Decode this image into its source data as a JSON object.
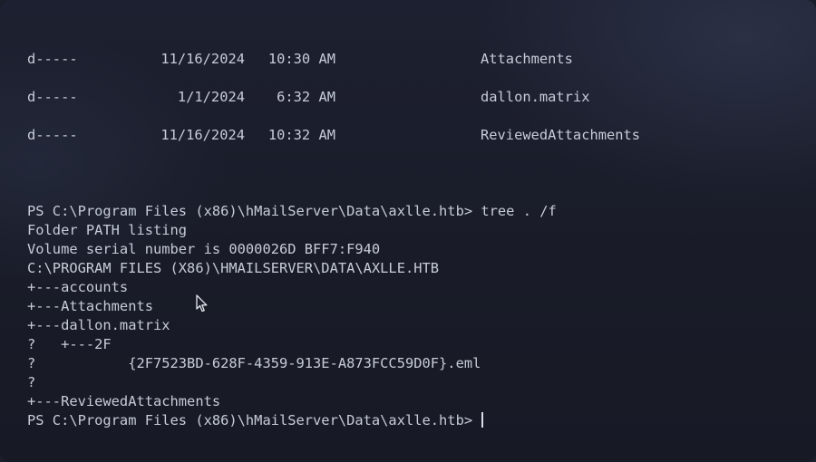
{
  "terminal": {
    "dir_listing": [
      {
        "mode": "d-----",
        "date": "11/16/2024",
        "time": "10:30 AM",
        "name": "Attachments"
      },
      {
        "mode": "d-----",
        "date": "1/1/2024",
        "time": "6:32 AM",
        "name": "dallon.matrix"
      },
      {
        "mode": "d-----",
        "date": "11/16/2024",
        "time": "10:32 AM",
        "name": "ReviewedAttachments"
      }
    ],
    "lines": [
      "PS C:\\Program Files (x86)\\hMailServer\\Data\\axlle.htb> tree . /f",
      "Folder PATH listing",
      "Volume serial number is 0000026D BFF7:F940",
      "C:\\PROGRAM FILES (X86)\\HMAILSERVER\\DATA\\AXLLE.HTB",
      "+---accounts",
      "+---Attachments",
      "+---dallon.matrix",
      "?   +---2F",
      "?           {2F7523BD-628F-4359-913E-A873FCC59D0F}.eml",
      "?",
      "+---ReviewedAttachments"
    ],
    "prompt": "PS C:\\Program Files (x86)\\hMailServer\\Data\\axlle.htb> "
  },
  "colors": {
    "background": "#1a1d2a",
    "text": "#c7ccd9",
    "caret": "#d8dce8"
  },
  "icons": {
    "pointer": "mouse-pointer-icon"
  }
}
